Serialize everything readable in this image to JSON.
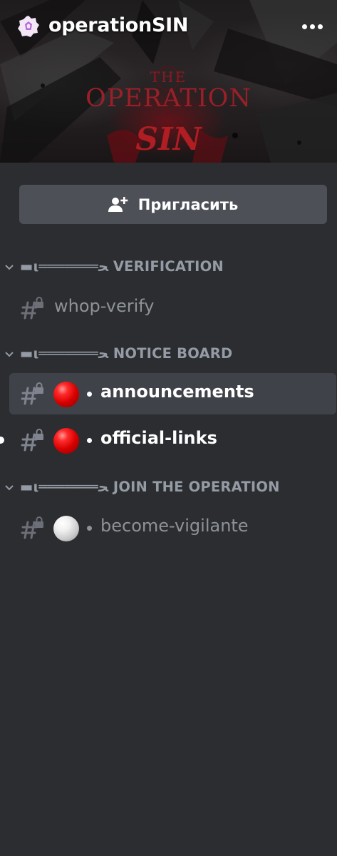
{
  "server": {
    "name": "operationSIN",
    "banner": {
      "line1": "THE",
      "line2": "OPERATION",
      "line3": "SIN"
    }
  },
  "invite": {
    "label": "Пригласить"
  },
  "categories": [
    {
      "label": "▬ι═══════ﺤ VERIFICATION",
      "channels": [
        {
          "name": "whop-verify",
          "emoji": "",
          "state": "muted"
        }
      ]
    },
    {
      "label": "▬ι═══════ﺤ NOTICE BOARD",
      "channels": [
        {
          "name": "announcements",
          "emoji": "red-ball",
          "state": "selected"
        },
        {
          "name": "official-links",
          "emoji": "red-ball",
          "state": "unread"
        }
      ]
    },
    {
      "label": "▬ι═══════ﺤ JOIN THE OPERATION",
      "channels": [
        {
          "name": "become-vigilante",
          "emoji": "white-ball",
          "state": "muted"
        }
      ]
    }
  ],
  "colors": {
    "background": "#2b2d31",
    "button": "#4e5058",
    "selected_row": "#404249",
    "muted_text": "#8e9297",
    "category_text": "#949ba4",
    "server_icon": "#f3e6f7",
    "server_icon_inner": "#b46bd6"
  }
}
